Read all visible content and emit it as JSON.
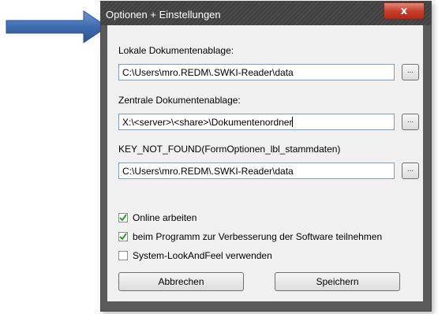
{
  "dialog": {
    "title": "Optionen + Einstellungen",
    "close_label": "x"
  },
  "fields": [
    {
      "label": "Lokale Dokumentenablage:",
      "value": "C:\\Users\\mro.REDM\\.SWKI-Reader\\data",
      "browse_label": "..."
    },
    {
      "label": "Zentrale Dokumentenablage:",
      "value": "X:\\<server>\\<share>\\Dokumentenordner",
      "browse_label": "..."
    },
    {
      "label": "KEY_NOT_FOUND(FormOptionen_lbl_stammdaten)",
      "value": "C:\\Users\\mro.REDM\\.SWKI-Reader\\data",
      "browse_label": "..."
    }
  ],
  "checkboxes": [
    {
      "label": "Online arbeiten",
      "checked": true
    },
    {
      "label": "beim Programm zur Verbesserung der Software teilnehmen",
      "checked": true
    },
    {
      "label": "System-LookAndFeel verwenden",
      "checked": false
    }
  ],
  "buttons": {
    "cancel": "Abbrechen",
    "save": "Speichern"
  },
  "colors": {
    "arrow": "#4a78b8",
    "check": "#2e9a2e"
  },
  "icons": {
    "close": "close-icon",
    "pointer": "arrow-right-icon"
  }
}
